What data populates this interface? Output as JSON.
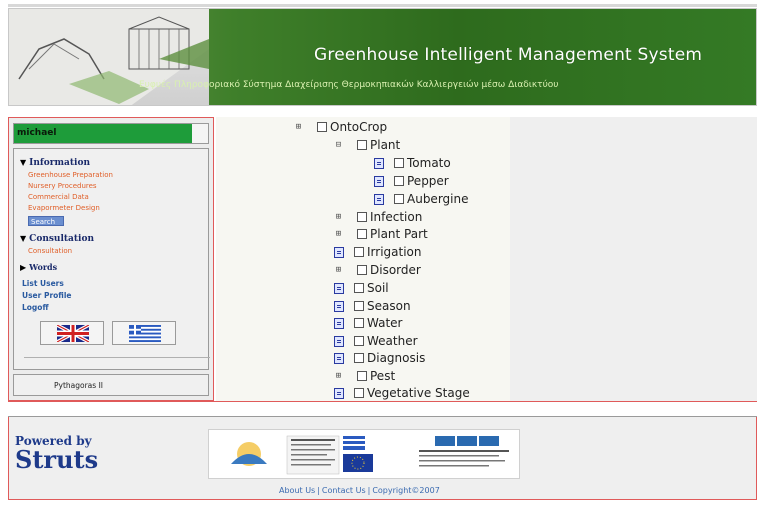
{
  "header": {
    "title": "Greenhouse Intelligent Management System",
    "subtitle": "Ευφυές Πληροφοριακό Σύστημα Διαχείρισης Θερμοκηπιακών Καλλιεργειών μέσω Διαδικτύου"
  },
  "sidebar": {
    "user": "michael",
    "sections": {
      "information": {
        "label": "Information",
        "items": [
          "Greenhouse Preparation",
          "Nursery Procedures",
          "Commercial Data",
          "Evapormeter Design"
        ],
        "search_label": "Search"
      },
      "consultation": {
        "label": "Consultation",
        "items": [
          "Consultation"
        ]
      },
      "words": {
        "label": "Words"
      }
    },
    "links": [
      "List Users",
      "User Profile",
      "Logoff"
    ],
    "footer": "Pythagoras II"
  },
  "tree": {
    "root": "OntoCrop",
    "nodes": [
      {
        "label": "Plant",
        "depth": 1,
        "kind": "expanded"
      },
      {
        "label": "Tomato",
        "depth": 2,
        "kind": "leaf"
      },
      {
        "label": "Pepper",
        "depth": 2,
        "kind": "leaf"
      },
      {
        "label": "Aubergine",
        "depth": 2,
        "kind": "leaf"
      },
      {
        "label": "Infection",
        "depth": 1,
        "kind": "collapsed"
      },
      {
        "label": "Plant Part",
        "depth": 1,
        "kind": "collapsed"
      },
      {
        "label": "Irrigation",
        "depth": 1,
        "kind": "leaf"
      },
      {
        "label": "Disorder",
        "depth": 1,
        "kind": "collapsed"
      },
      {
        "label": "Soil",
        "depth": 1,
        "kind": "leaf"
      },
      {
        "label": "Season",
        "depth": 1,
        "kind": "leaf"
      },
      {
        "label": "Water",
        "depth": 1,
        "kind": "leaf"
      },
      {
        "label": "Weather",
        "depth": 1,
        "kind": "leaf"
      },
      {
        "label": "Diagnosis",
        "depth": 1,
        "kind": "leaf"
      },
      {
        "label": "Pest",
        "depth": 1,
        "kind": "collapsed"
      },
      {
        "label": "Vegetative Stage",
        "depth": 1,
        "kind": "leaf"
      }
    ]
  },
  "footer": {
    "powered_small": "Powered by",
    "powered_big": "Struts",
    "links": [
      "About Us",
      "Contact Us",
      "Copyright©2007"
    ]
  },
  "colors": {
    "accent_green": "#1e9c3a",
    "link_orange": "#e0602a",
    "link_blue": "#2a5aa0",
    "border_red": "#e05a5a"
  }
}
